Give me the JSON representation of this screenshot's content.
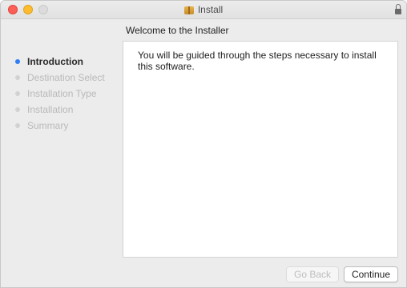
{
  "window": {
    "title": "Install"
  },
  "heading": "Welcome to the  Installer",
  "steps": [
    {
      "label": "Introduction",
      "active": true
    },
    {
      "label": "Destination Select",
      "active": false
    },
    {
      "label": "Installation Type",
      "active": false
    },
    {
      "label": "Installation",
      "active": false
    },
    {
      "label": "Summary",
      "active": false
    }
  ],
  "content": {
    "text": "You will be guided through the steps necessary to install this software."
  },
  "buttons": {
    "back_label": "Go Back",
    "continue_label": "Continue"
  },
  "icons": {
    "title": "package-icon",
    "lock": "lock-icon"
  },
  "colors": {
    "active_step": "#2f7ef5",
    "close": "#fd5f57",
    "minimize": "#fdbc2e"
  }
}
